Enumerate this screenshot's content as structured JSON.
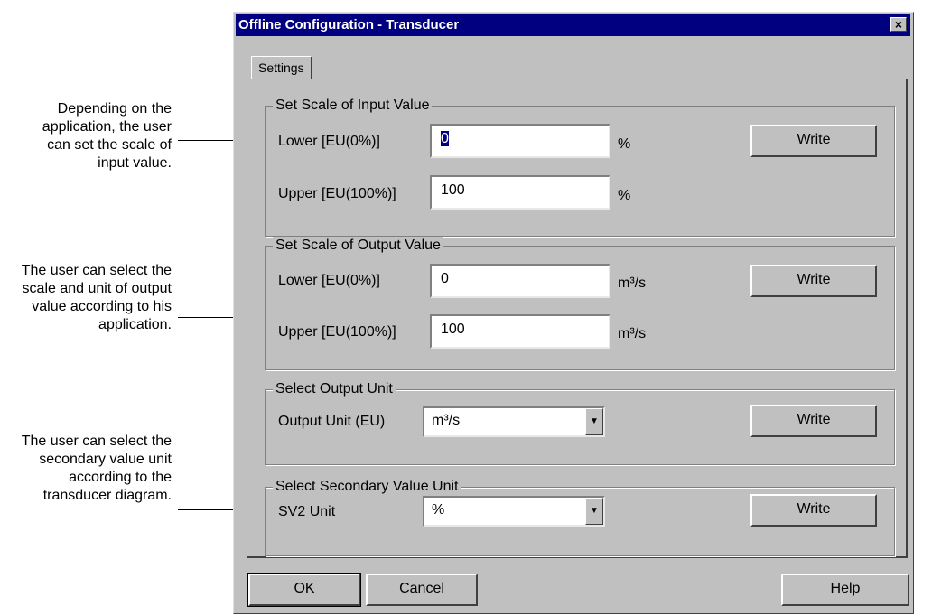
{
  "annotations": {
    "input_scale": "Depending on the application, the user can set the scale of input value.",
    "output_scale": "The user can select the scale and unit of output value according to his application.",
    "secondary_unit": "The user can select the secondary value unit according to the transducer diagram."
  },
  "dialog": {
    "title": "Offline Configuration - Transducer",
    "close_glyph": "×",
    "tab": "Settings"
  },
  "input_scale": {
    "group_label": "Set Scale of Input Value",
    "lower_label": "Lower [EU(0%)]",
    "lower_value": "0",
    "lower_unit": "%",
    "upper_label": "Upper [EU(100%)]",
    "upper_value": "100",
    "upper_unit": "%",
    "write": "Write"
  },
  "output_scale": {
    "group_label": "Set Scale of Output Value",
    "lower_label": "Lower [EU(0%)]",
    "lower_value": "0",
    "lower_unit": "m³/s",
    "upper_label": "Upper [EU(100%)]",
    "upper_value": "100",
    "upper_unit": "m³/s",
    "write": "Write"
  },
  "output_unit": {
    "group_label": "Select Output Unit",
    "label": "Output Unit (EU)",
    "value": "m³/s",
    "write": "Write"
  },
  "secondary_unit": {
    "group_label": "Select Secondary Value Unit",
    "label": "SV2 Unit",
    "value": "%",
    "write": "Write"
  },
  "footer": {
    "ok": "OK",
    "cancel": "Cancel",
    "help": "Help"
  },
  "icons": {
    "dropdown_arrow": "▼"
  }
}
